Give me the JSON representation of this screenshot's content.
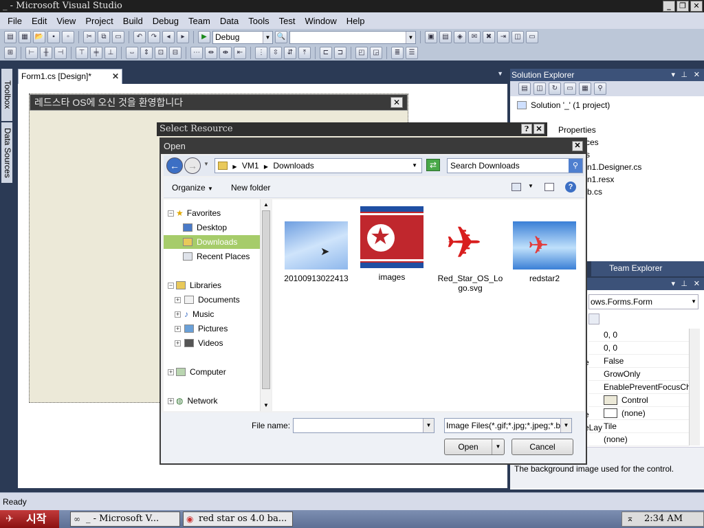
{
  "window": {
    "title": "_ - Microsoft Visual Studio"
  },
  "menu": [
    "File",
    "Edit",
    "View",
    "Project",
    "Build",
    "Debug",
    "Team",
    "Data",
    "Tools",
    "Test",
    "Window",
    "Help"
  ],
  "toolbar": {
    "config": "Debug",
    "platform": ""
  },
  "left_tabs": [
    "Toolbox",
    "Data Sources"
  ],
  "document": {
    "tab_label": "Form1.cs [Design]*",
    "form_title": "레드스타 OS에 오신 것을 환영합니다"
  },
  "solution_explorer": {
    "title": "Solution Explorer",
    "items": [
      "Solution '_' (1 project)",
      "Properties",
      "ces",
      "s",
      "n1.Designer.cs",
      "n1.resx",
      "b.cs"
    ]
  },
  "team_explorer": {
    "label": "Team Explorer"
  },
  "properties": {
    "selected": "ows.Forms.Form",
    "values": [
      "0, 0",
      "0, 0",
      "False",
      "GrowOnly",
      "EnablePreventFocusCh",
      "Control",
      "(none)",
      "Tile",
      "(none)"
    ],
    "side_labels": [
      "e",
      "e",
      "eLay"
    ],
    "description": "The background image used for the control."
  },
  "status": {
    "text": "Ready"
  },
  "taskbar": {
    "start": "시작",
    "items": [
      "_ - Microsoft V...",
      "red star os 4.0 ba..."
    ],
    "clock": "2:34 AM"
  },
  "select_resource": {
    "title": "Select Resource"
  },
  "open_dialog": {
    "title": "Open",
    "breadcrumb": [
      "VM1",
      "Downloads"
    ],
    "search_placeholder": "Search Downloads",
    "organize": "Organize",
    "new_folder": "New folder",
    "nav": {
      "favorites": "Favorites",
      "favorites_items": [
        "Desktop",
        "Downloads",
        "Recent Places"
      ],
      "libraries": "Libraries",
      "libraries_items": [
        "Documents",
        "Music",
        "Pictures",
        "Videos"
      ],
      "computer": "Computer",
      "network": "Network"
    },
    "files": [
      {
        "name": "20100913022413",
        "kind": "sky"
      },
      {
        "name": "images",
        "kind": "flag"
      },
      {
        "name": "Red_Star_OS_Logo.svg",
        "kind": "logo"
      },
      {
        "name": "redstar2",
        "kind": "wallpaper"
      }
    ],
    "file_name_label": "File name:",
    "file_name_value": "",
    "filter": "Image Files(*.gif;*.jpg;*.jpeg;*.b",
    "open_button": "Open",
    "cancel_button": "Cancel"
  }
}
